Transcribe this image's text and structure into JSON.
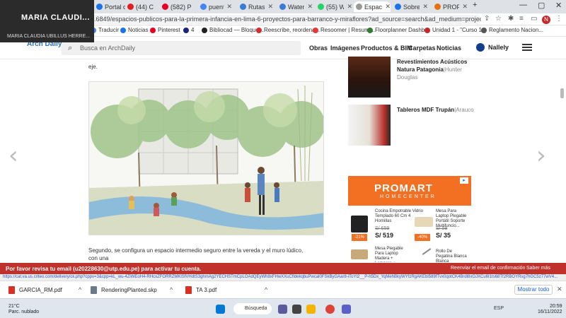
{
  "profile": {
    "name": "MARIA CLAUDI...",
    "subtitle": "MARIA CLAUDIA UBILLUS HERRE..."
  },
  "tabs": [
    {
      "label": "Portal d",
      "color": "#1a73e8",
      "active": false
    },
    {
      "label": "(44) C",
      "color": "#e02020",
      "active": false
    },
    {
      "label": "(582) P",
      "color": "#e60023",
      "active": false
    },
    {
      "label": "puente",
      "color": "#4285f4",
      "active": false
    },
    {
      "label": "Rutas",
      "color": "#3a7bd5",
      "active": false
    },
    {
      "label": "Water",
      "color": "#3a7bd5",
      "active": false
    },
    {
      "label": "(55) W",
      "color": "#25d366",
      "active": false
    },
    {
      "label": "Espaci",
      "color": "#999",
      "active": true
    },
    {
      "label": "Sobre",
      "color": "#1a73e8",
      "active": false
    },
    {
      "label": "PROP",
      "color": "#e8710a",
      "active": false
    }
  ],
  "address": {
    "url": "...6849/espacios-publicos-para-la-primera-infancia-en-lima-6-proyectos-para-barranco-y-miraflores?ad_source=search&ad_medium=projects_tab&ad_source=sea..."
  },
  "profile_initial": "N",
  "bookmarks": [
    "Traducir",
    "Noticias",
    "Pinterest",
    "4",
    "Bibliocad — Bloque...",
    "Reescribe, reordena...",
    "Resoomer | Resumi...",
    "Floorplanner Dashb...",
    "Unidad 1 - \"Curso 1...",
    "Reglamento Nacion..."
  ],
  "site": {
    "logo": "Arch Daily",
    "search_placeholder": "Busca en ArchDaily",
    "nav": [
      "Obras",
      "Imágenes",
      "Productos & BIM",
      "Carpetas",
      "Noticias"
    ],
    "user": "Nallely"
  },
  "article": {
    "intro": "eje.",
    "paragraph": "Segundo, se configura un espacio intermedio seguro entre la vereda y el muro lúdico, con una"
  },
  "sidebar": {
    "product1": {
      "name": "Revestimientos Acústicos Natura",
      "sep": "|",
      "line2": "Patagonia",
      "brand": "Hunter Douglas"
    },
    "product2": {
      "name": "Tableros MDF Trupán",
      "sep": "|",
      "brand": "Arauco"
    }
  },
  "ad": {
    "brand": "PROMART",
    "tagline": "HOMECENTER",
    "items": [
      {
        "desc": "Cocina Empotrable Vidrio Templado 60 Cm 4 Hornillas",
        "old": "S/ 659",
        "price": "S/ 519",
        "disc": "-21%"
      },
      {
        "desc": "Mesa Para Laptop Plegable Portátil Soporte Multifuncio...",
        "old": "S/ 59",
        "price": "S/ 35",
        "disc": "-40%"
      },
      {
        "desc": "Mesa Plegable Para Laptop Madera + Lampara +...",
        "old": "",
        "price": "",
        "disc": ""
      },
      {
        "desc": "Rollo De Pegatina Blanca Blanca",
        "old": "",
        "price": "",
        "disc": ""
      }
    ]
  },
  "banner": {
    "message": "Por favor revisa tu email (u20228630@utp.edu.pe) para activar tu cuenta.",
    "resend": "Reenviar el email de confirmación",
    "more": "Saber más"
  },
  "status_url": "https://cat.va.us.criteo.com/delivery/ck.php?cppv=3&cpp=kL_wu-4ZiWEoH4-RHcxZFORRZMKlSfVHdtS3ghmAg2YECHSTmCpLOAdQEyWh8xFHwXXuCfldekqbuPwcal0FSkByGAar8-iToYt2__P-h5Dx_YqMehBkyWYfzRgAKEbl589fTvx0qotCK4Brdl8xOJXCu6I1ts68Tf2RBOYRsg7hGC5z77wV4...",
  "downloads": [
    {
      "name": "GARCIA_RM.pdf",
      "color": "#d93025"
    },
    {
      "name": "RenderingPlanted.skp",
      "color": "#6b7a8a"
    },
    {
      "name": "TA 3.pdf",
      "color": "#d93025"
    }
  ],
  "show_all": "Mostrar todo",
  "taskbar": {
    "temp": "21°C",
    "weather": "Parc. nublado",
    "search": "Búsqueda",
    "lang": "ESP",
    "time": "20:59",
    "date": "16/11/2022"
  }
}
